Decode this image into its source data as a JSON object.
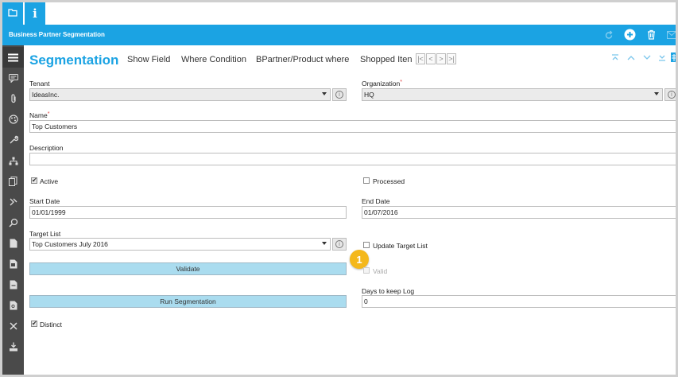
{
  "colors": {
    "accent": "#1ba3e3",
    "sidebar": "#4a4a4a",
    "button": "#aadcef",
    "callout": "#f4b81c"
  },
  "tabs": {
    "folder_icon": "folder-icon",
    "info_label": "i"
  },
  "window": {
    "title": "Business Partner Segmentation"
  },
  "toolbar": {
    "heading": "Segmentation",
    "tabs": [
      "Show Field",
      "Where Condition",
      "BPartner/Product where",
      "Shopped Iten"
    ],
    "nav": [
      "|<",
      "<",
      ">",
      ">|"
    ]
  },
  "form": {
    "tenant": {
      "label": "Tenant",
      "value": "IdeasInc."
    },
    "organization": {
      "label": "Organization",
      "value": "HQ"
    },
    "name": {
      "label": "Name",
      "value": "Top Customers"
    },
    "description": {
      "label": "Description",
      "value": ""
    },
    "active": {
      "label": "Active",
      "checked": true
    },
    "processed": {
      "label": "Processed",
      "checked": false
    },
    "start_date": {
      "label": "Start Date",
      "value": "01/01/1999"
    },
    "end_date": {
      "label": "End Date",
      "value": "01/07/2016"
    },
    "target_list": {
      "label": "Target List",
      "value": "Top Customers July 2016"
    },
    "update_target_list": {
      "label": "Update Target List",
      "checked": false
    },
    "validate_button": "Validate",
    "valid": {
      "label": "Valid",
      "checked": false
    },
    "days_to_keep_log": {
      "label": "Days to keep Log",
      "value": "0"
    },
    "run_button": "Run Segmentation",
    "distinct": {
      "label": "Distinct",
      "checked": true
    }
  },
  "callout": {
    "number": "1"
  },
  "required_mark": "*"
}
